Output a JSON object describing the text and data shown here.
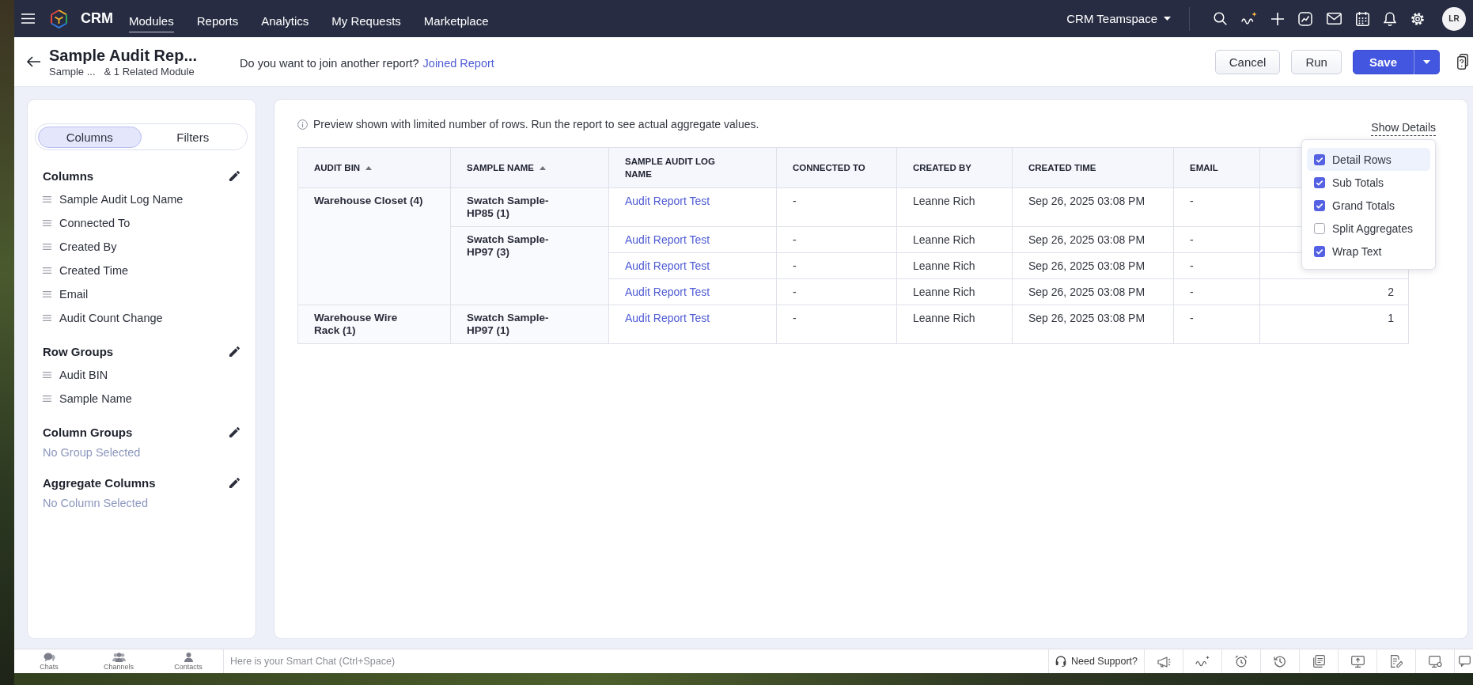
{
  "top_bar": {
    "product": "CRM",
    "nav": [
      {
        "label": "Modules",
        "selected": true
      },
      {
        "label": "Reports",
        "selected": false
      },
      {
        "label": "Analytics",
        "selected": false
      },
      {
        "label": "My Requests",
        "selected": false
      },
      {
        "label": "Marketplace",
        "selected": false
      }
    ],
    "workspace": "CRM Teamspace",
    "avatar": "LR"
  },
  "report_header": {
    "title": "Sample Audit Rep...",
    "module": "Sample ...",
    "related": "& 1 Related Module",
    "join_prompt": "Do you want to join another report?",
    "join_link": "Joined Report",
    "buttons": [
      {
        "label": "Cancel",
        "kind": "secondary"
      },
      {
        "label": "Run",
        "kind": "secondary"
      },
      {
        "label": "Save",
        "kind": "primary"
      }
    ]
  },
  "side_panel": {
    "tabs": [
      {
        "label": "Columns",
        "selected": true
      },
      {
        "label": "Filters",
        "selected": false
      }
    ],
    "sections": [
      {
        "title": "Columns",
        "items": [
          "Sample Audit Log Name",
          "Connected To",
          "Created By",
          "Created Time",
          "Email",
          "Audit Count Change"
        ]
      },
      {
        "title": "Row Groups",
        "items": [
          "Audit BIN",
          "Sample Name"
        ]
      },
      {
        "title": "Column Groups",
        "empty": "No Group Selected"
      },
      {
        "title": "Aggregate Columns",
        "empty": "No Column Selected"
      }
    ]
  },
  "report": {
    "notice": "Preview shown with limited number of rows. Run the report to see actual aggregate values.",
    "show_details": {
      "label": "Show Details",
      "items": [
        {
          "label": "Detail Rows",
          "checked": true,
          "hovered": true
        },
        {
          "label": "Sub Totals",
          "checked": true,
          "hovered": false
        },
        {
          "label": "Grand Totals",
          "checked": true,
          "hovered": false
        },
        {
          "label": "Split Aggregates",
          "checked": false,
          "hovered": false
        },
        {
          "label": "Wrap Text",
          "checked": true,
          "hovered": false
        }
      ]
    },
    "table": {
      "columns": [
        {
          "label": "AUDIT BIN",
          "sorted": true
        },
        {
          "label": "SAMPLE NAME",
          "sorted": true
        },
        {
          "label": "SAMPLE AUDIT LOG NAME",
          "sorted": false
        },
        {
          "label": "CONNECTED TO",
          "sorted": false
        },
        {
          "label": "CREATED BY",
          "sorted": false
        },
        {
          "label": "CREATED TIME",
          "sorted": false
        },
        {
          "label": "EMAIL",
          "sorted": false
        }
      ],
      "groups": [
        {
          "audit_bin": "Warehouse Closet (4)",
          "samples": [
            {
              "name": "Swatch Sample-HP85 (1)",
              "records": [
                {
                  "cells": [
                    "Audit Report Test",
                    "-",
                    "Leanne Rich",
                    "Sep 26, 2025 03:08 PM",
                    "-"
                  ]
                }
              ]
            },
            {
              "name": "Swatch Sample-HP97 (3)",
              "records": [
                {
                  "cells": [
                    "Audit Report Test",
                    "-",
                    "Leanne Rich",
                    "Sep 26, 2025 03:08 PM",
                    "-"
                  ]
                },
                {
                  "cells": [
                    "Audit Report Test",
                    "-",
                    "Leanne Rich",
                    "Sep 26, 2025 03:08 PM",
                    "-"
                  ]
                },
                {
                  "cells": [
                    "Audit Report Test",
                    "-",
                    "Leanne Rich",
                    "Sep 26, 2025 03:08 PM",
                    "-"
                  ],
                  "column_8": "2"
                }
              ]
            }
          ]
        },
        {
          "audit_bin": "Warehouse Wire Rack (1)",
          "samples": [
            {
              "name": "Swatch Sample-HP97 (1)",
              "records": [
                {
                  "cells": [
                    "Audit Report Test",
                    "-",
                    "Leanne Rich",
                    "Sep 26, 2025 03:08 PM",
                    "-"
                  ],
                  "column_8": "1"
                }
              ]
            }
          ]
        }
      ]
    }
  },
  "bottom_bar": {
    "apps": [
      "Chats",
      "Channels",
      "Contacts"
    ],
    "chat_placeholder": "Here is your Smart Chat (Ctrl+Space)",
    "support": "Need Support?"
  }
}
